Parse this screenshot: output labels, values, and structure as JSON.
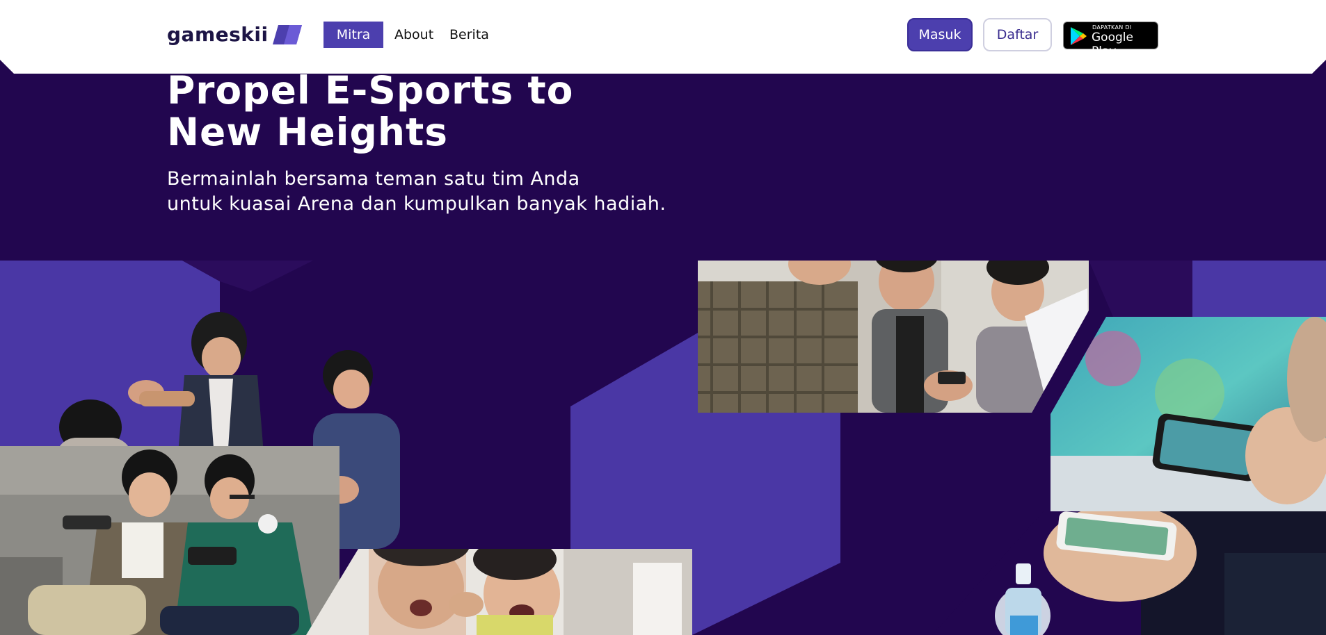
{
  "header": {
    "logo_text": "gameskii",
    "nav": [
      {
        "label": "Mitra"
      },
      {
        "label": "About"
      },
      {
        "label": "Berita"
      }
    ],
    "login_label": "Masuk",
    "register_label": "Daftar",
    "google_play": {
      "small_text": "DAPATKAN DI",
      "big_text": "Google Play"
    }
  },
  "hero": {
    "title_line1": "Propel E-Sports to",
    "title_line2": "New Heights",
    "subtitle_line1": "Bermainlah bersama teman satu tim Anda",
    "subtitle_line2": "untuk kuasai Arena dan kumpulkan banyak hadiah."
  },
  "colors": {
    "background": "#22064f",
    "accent": "#4c3fae",
    "panel": "#4a37a5"
  },
  "photos": [
    {
      "name": "photo-friends-celebrating"
    },
    {
      "name": "photo-two-boys-phones"
    },
    {
      "name": "photo-kids-shouting"
    },
    {
      "name": "photo-friends-laughing-phones"
    },
    {
      "name": "photo-mobile-game-closeup"
    },
    {
      "name": "photo-hands-phone-drink"
    }
  ]
}
